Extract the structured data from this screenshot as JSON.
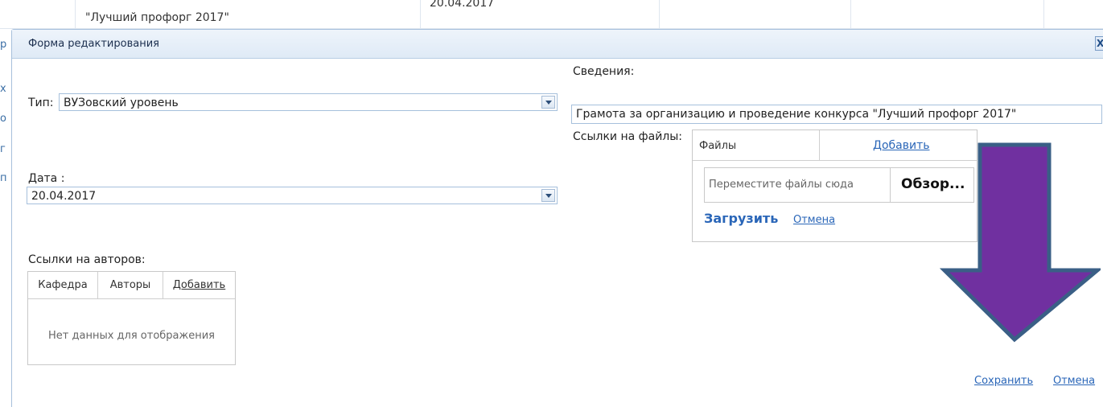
{
  "background": {
    "row_text": "\"Лучший профорг 2017\"",
    "row_date": "20.04.2017"
  },
  "popup": {
    "title": "Форма редактирования",
    "close_glyph": "X"
  },
  "form": {
    "type_label": "Тип:",
    "type_value": "ВУЗовский уровень",
    "date_label": "Дата :",
    "date_value": "20.04.2017",
    "authors_label": "Ссылки на авторов:",
    "info_label": "Сведения:",
    "info_value": "Грамота за организацию и проведение конкурса \"Лучший профорг 2017\"",
    "files_label": "Ссылки на файлы:"
  },
  "authors_table": {
    "col_department": "Кафедра",
    "col_authors": "Авторы",
    "add_link": "Добавить",
    "empty_text": "Нет данных для отображения"
  },
  "files_table": {
    "col_files": "Файлы",
    "add_link": "Добавить",
    "drop_placeholder": "Переместите файлы сюда",
    "browse_label": "Обзор...",
    "upload_label": "Загрузить",
    "cancel_label": "Отмена"
  },
  "footer": {
    "save_label": "Сохранить",
    "cancel_label": "Отмена"
  },
  "colors": {
    "arrow_fill": "#7030a0",
    "arrow_border": "#3a5f86",
    "link": "#2a66b8",
    "header_bg": "#dfeaf6"
  },
  "icons": {
    "dropdown": "triangle-down-icon",
    "close": "close-icon",
    "annotation": "arrow-down-icon"
  }
}
